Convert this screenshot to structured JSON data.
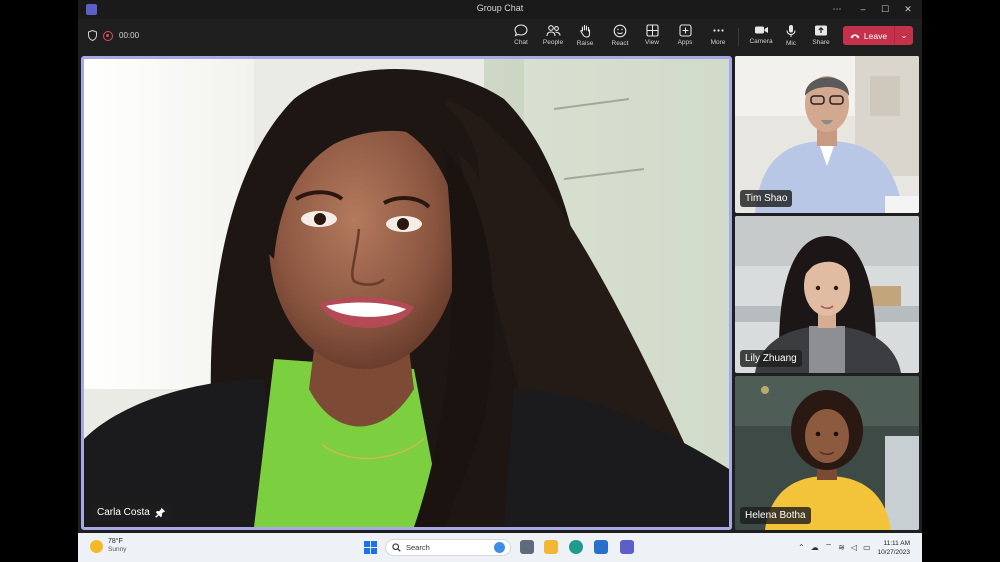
{
  "window": {
    "title": "Group Chat",
    "controls": [
      "more",
      "minimize",
      "maximize",
      "close"
    ]
  },
  "meeting": {
    "timer": "00:00",
    "toolbar": [
      {
        "label": "Chat",
        "icon": "chat-icon"
      },
      {
        "label": "People",
        "icon": "people-icon"
      },
      {
        "label": "Raise",
        "icon": "raise-hand-icon"
      },
      {
        "label": "React",
        "icon": "react-icon"
      },
      {
        "label": "View",
        "icon": "view-icon"
      },
      {
        "label": "Apps",
        "icon": "apps-icon"
      },
      {
        "label": "More",
        "icon": "more-icon"
      },
      {
        "label": "Camera",
        "icon": "camera-icon"
      },
      {
        "label": "Mic",
        "icon": "mic-icon"
      },
      {
        "label": "Share",
        "icon": "share-icon"
      }
    ],
    "leave_label": "Leave"
  },
  "participants": {
    "main": {
      "name": "Carla Costa",
      "icon": "pin-icon"
    },
    "tiles": [
      {
        "name": "Tim Shao"
      },
      {
        "name": "Lily Zhuang"
      },
      {
        "name": "Helena Botha"
      }
    ]
  },
  "taskbar": {
    "weather_temp": "78°F",
    "weather_desc": "Sunny",
    "search_placeholder": "Search",
    "time": "11:11 AM",
    "date": "10/27/2023"
  },
  "colors": {
    "accent": "#a7a9e6",
    "leave": "#c4314b",
    "teams": "#5b5fc7"
  }
}
